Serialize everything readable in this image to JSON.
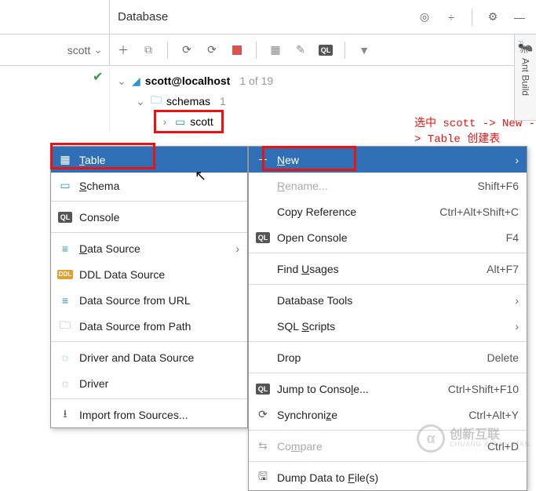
{
  "panel": {
    "title": "Database"
  },
  "row2_left": {
    "label": "scott"
  },
  "tree": {
    "root": {
      "label": "scott@localhost",
      "count": "1 of 19"
    },
    "schemas": {
      "label": "schemas",
      "count": "1"
    },
    "scott": {
      "label": "scott"
    }
  },
  "annotation": "选中 scott -> New -> Table 创建表",
  "submenu_new": {
    "items": [
      {
        "key": "table",
        "label": "Table",
        "icon": "table-icon",
        "selected": true
      },
      {
        "key": "schema",
        "label": "Schema",
        "icon": "schema-icon"
      },
      {
        "sep": true
      },
      {
        "key": "console",
        "label": "Console",
        "icon": "ql-icon"
      },
      {
        "sep": true
      },
      {
        "key": "datasource",
        "label": "Data Source",
        "icon": "disks-icon",
        "arrow": true
      },
      {
        "key": "ddl",
        "label": "DDL Data Source",
        "icon": "ddl-icon"
      },
      {
        "key": "url",
        "label": "Data Source from URL",
        "icon": "disks-icon"
      },
      {
        "key": "path",
        "label": "Data Source from Path",
        "icon": "folder-gray-icon"
      },
      {
        "sep": true
      },
      {
        "key": "driver-ds",
        "label": "Driver and Data Source",
        "icon": "driver-icon"
      },
      {
        "key": "driver",
        "label": "Driver",
        "icon": "driver-icon"
      },
      {
        "sep": true
      },
      {
        "key": "import",
        "label": "Import from Sources...",
        "icon": "import-icon"
      }
    ]
  },
  "context_menu": {
    "items": [
      {
        "key": "new",
        "label": "New",
        "icon": "plus-icon",
        "arrow": true,
        "selected": true
      },
      {
        "key": "rename",
        "label": "Rename...",
        "shortcut": "Shift+F6",
        "disabled": true
      },
      {
        "key": "copyref",
        "label": "Copy Reference",
        "shortcut": "Ctrl+Alt+Shift+C"
      },
      {
        "key": "openconsole",
        "label": "Open Console",
        "shortcut": "F4",
        "icon": "ql-icon"
      },
      {
        "sep": true
      },
      {
        "key": "findusages",
        "label": "Find Usages",
        "shortcut": "Alt+F7"
      },
      {
        "sep": true
      },
      {
        "key": "dbtools",
        "label": "Database Tools",
        "arrow": true
      },
      {
        "key": "sqlscripts",
        "label": "SQL Scripts",
        "arrow": true
      },
      {
        "sep": true
      },
      {
        "key": "drop",
        "label": "Drop",
        "shortcut": "Delete"
      },
      {
        "sep": true
      },
      {
        "key": "jumpconsole",
        "label": "Jump to Console...",
        "shortcut": "Ctrl+Shift+F10",
        "icon": "ql-icon"
      },
      {
        "key": "sync",
        "label": "Synchronize",
        "shortcut": "Ctrl+Alt+Y",
        "icon": "sync-icon"
      },
      {
        "sep": true
      },
      {
        "key": "compare",
        "label": "Compare",
        "shortcut": "Ctrl+D",
        "icon": "compare-icon",
        "disabled": true
      },
      {
        "sep": true
      },
      {
        "key": "dump",
        "label": "Dump Data to File(s)",
        "icon": "save-icon"
      }
    ]
  },
  "sidetab": {
    "label": "Ant Build"
  },
  "watermark": {
    "big": "创新互联",
    "small": "CHUANG XIN HU LIAN",
    "mark": "α"
  }
}
